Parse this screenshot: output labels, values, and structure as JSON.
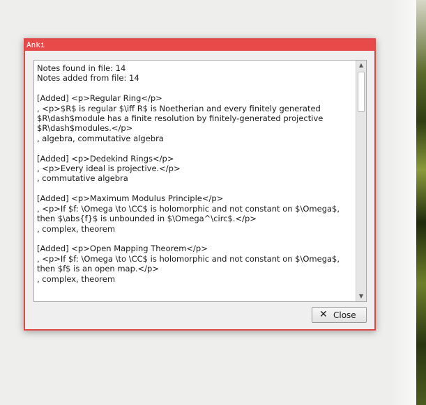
{
  "window": {
    "title": "Anki"
  },
  "report": {
    "text": "Notes found in file: 14\nNotes added from file: 14\n\n[Added] <p>Regular Ring</p>\n, <p>$R$ is regular $\\iff R$ is Noetherian and every finitely generated $R\\dash$module has a finite resolution by finitely-generated projective $R\\dash$modules.</p>\n, algebra, commutative algebra\n\n[Added] <p>Dedekind Rings</p>\n, <p>Every ideal is projective.</p>\n, commutative algebra\n\n[Added] <p>Maximum Modulus Principle</p>\n, <p>If $f: \\Omega \\to \\CC$ is holomorphic and not constant on $\\Omega$, then $\\abs{f}$ is unbounded in $\\Omega^\\circ$.</p>\n, complex, theorem\n\n[Added] <p>Open Mapping Theorem</p>\n, <p>If $f: \\Omega \\to \\CC$ is holomorphic and not constant on $\\Omega$, then $f$ is an open map.</p>\n, complex, theorem"
  },
  "buttons": {
    "close_label": "Close",
    "close_icon": "x-icon"
  },
  "colors": {
    "titlebar": "#e84a4a",
    "border": "#e04848"
  }
}
